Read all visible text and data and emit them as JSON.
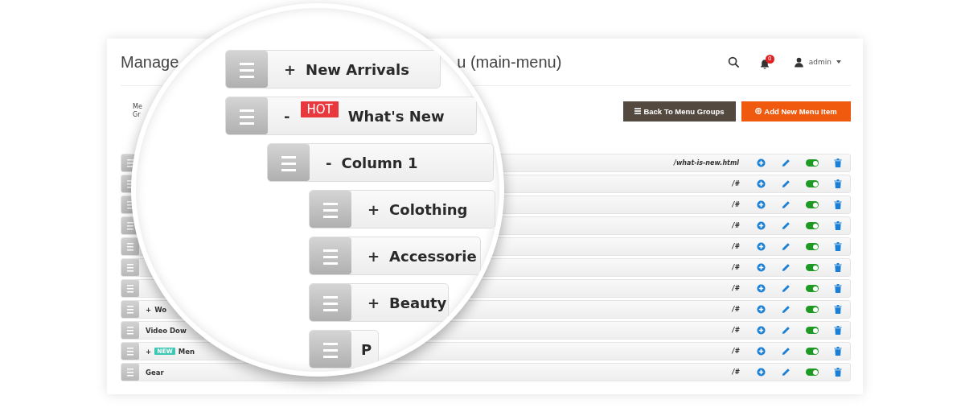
{
  "header": {
    "title_start": "Manage",
    "title_end": "u (main-menu)",
    "notifications": "0",
    "user": "admin"
  },
  "group_label": "Me Gr",
  "buttons": [
    {
      "kind": "back",
      "label": "Back To Menu Groups"
    },
    {
      "kind": "add",
      "label": "Add New Menu Item"
    }
  ],
  "rows": [
    {
      "url": "/what-is-new.html",
      "enabled": true
    },
    {
      "url": "/#",
      "enabled": true
    },
    {
      "url": "/#",
      "enabled": true
    },
    {
      "url": "/#",
      "enabled": true
    },
    {
      "url": "/#",
      "enabled": true
    },
    {
      "url": "/#",
      "enabled": true
    },
    {
      "url": "/#",
      "enabled": true
    },
    {
      "expander": "+",
      "label": "Wo",
      "url": "/#",
      "enabled": true
    },
    {
      "label": "Video Dow",
      "url": "/#",
      "enabled": true
    },
    {
      "expander": "+",
      "badge": {
        "text": "NEW",
        "color": "#3cc7b5"
      },
      "label": "Men",
      "url": "/#",
      "enabled": true
    },
    {
      "label": "Gear",
      "url": "/#",
      "enabled": true
    }
  ],
  "magnifier": {
    "items": [
      {
        "expander": "+",
        "label": "New Arrivals"
      },
      {
        "expander": "-",
        "badge": {
          "text": "HOT",
          "color": "#e8373d"
        },
        "label": "What's New",
        "children": [
          {
            "expander": "-",
            "label": "Column 1",
            "children": [
              {
                "expander": "+",
                "label": "Colothing"
              },
              {
                "expander": "+",
                "label": "Accessorie"
              },
              {
                "expander": "+",
                "label": "Beauty"
              },
              {
                "label": "P"
              }
            ]
          }
        ]
      }
    ]
  }
}
